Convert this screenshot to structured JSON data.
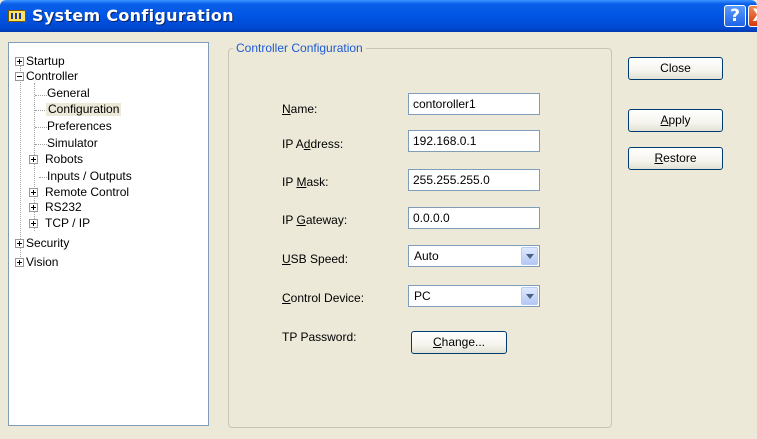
{
  "window": {
    "title": "System Configuration",
    "help_glyph": "?",
    "close_glyph": "X"
  },
  "tree": [
    {
      "label": "Startup",
      "expander": "+"
    },
    {
      "label": "Controller",
      "expander": "-"
    },
    {
      "label": "General"
    },
    {
      "label": "Configuration",
      "selected": true
    },
    {
      "label": "Preferences"
    },
    {
      "label": "Simulator"
    },
    {
      "label": "Robots",
      "expander": "+"
    },
    {
      "label": "Inputs / Outputs"
    },
    {
      "label": "Remote Control",
      "expander": "+"
    },
    {
      "label": "RS232",
      "expander": "+"
    },
    {
      "label": "TCP / IP",
      "expander": "+"
    },
    {
      "label": "Security",
      "expander": "+"
    },
    {
      "label": "Vision",
      "expander": "+"
    }
  ],
  "group": {
    "title": "Controller Configuration"
  },
  "fields": {
    "name": {
      "label_pre": "",
      "label_key": "N",
      "label_post": "ame:",
      "value": "contoroller1"
    },
    "ip_address": {
      "label_pre": "IP A",
      "label_key": "d",
      "label_post": "dress:",
      "value": "192.168.0.1"
    },
    "ip_mask": {
      "label_pre": "IP ",
      "label_key": "M",
      "label_post": "ask:",
      "value": "255.255.255.0"
    },
    "ip_gateway": {
      "label_pre": "IP ",
      "label_key": "G",
      "label_post": "ateway:",
      "value": "0.0.0.0"
    },
    "usb_speed": {
      "label_pre": "",
      "label_key": "U",
      "label_post": "SB Speed:",
      "value": "Auto"
    },
    "control_device": {
      "label_pre": "",
      "label_key": "C",
      "label_post": "ontrol Device:",
      "value": "PC"
    },
    "tp_password": {
      "label": "TP Password:",
      "button_key": "C",
      "button_rest": "hange..."
    }
  },
  "buttons": {
    "close": {
      "label": "Close"
    },
    "apply": {
      "key": "A",
      "rest": "pply"
    },
    "restore": {
      "key": "R",
      "rest": "estore"
    }
  }
}
